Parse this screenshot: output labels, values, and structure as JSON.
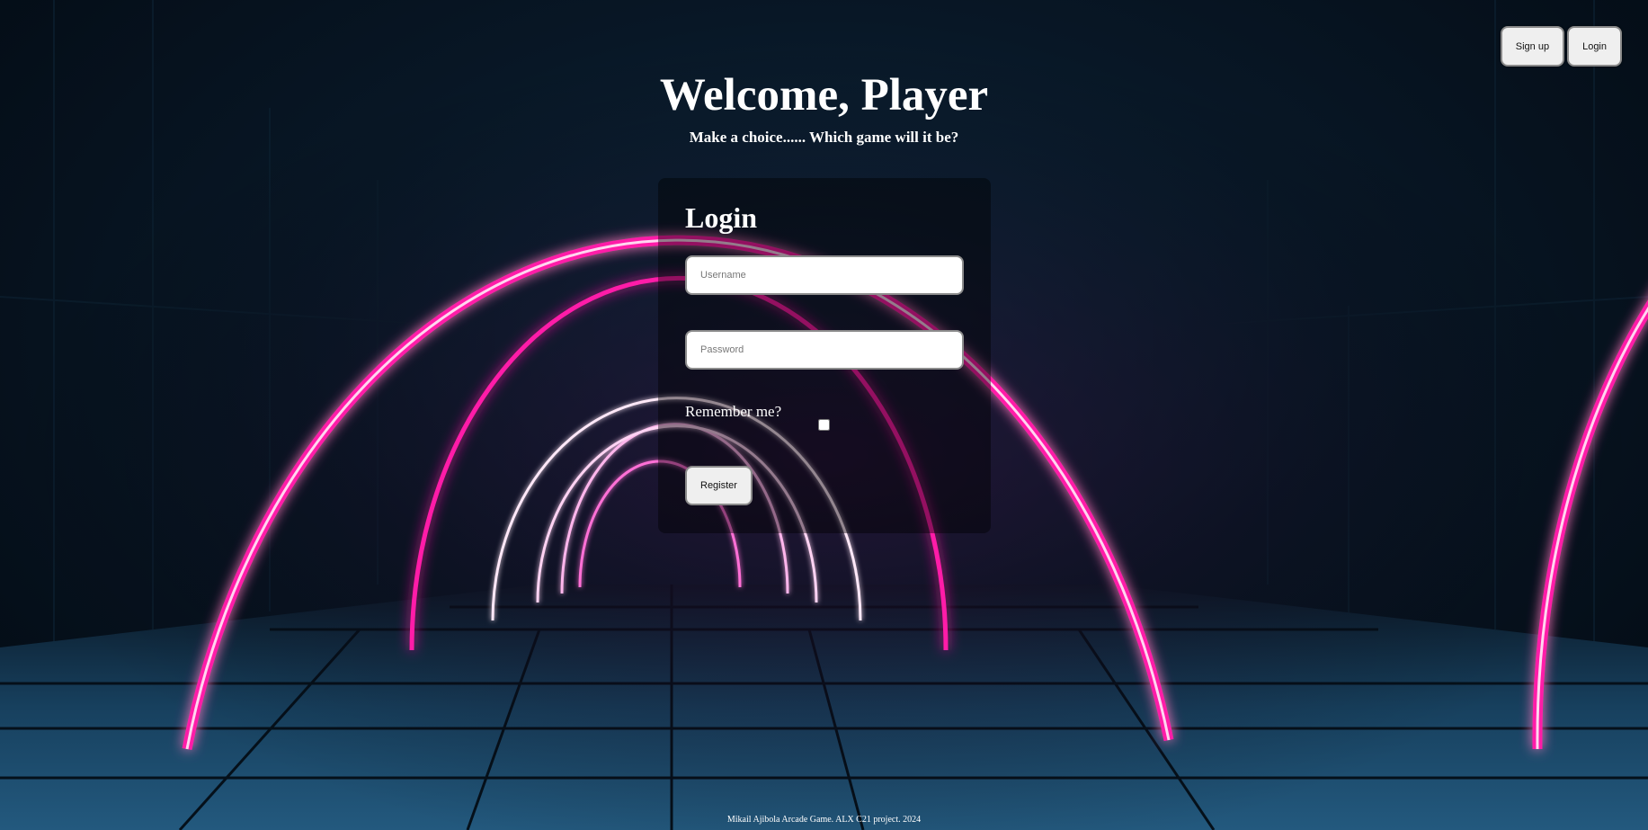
{
  "header": {
    "title": "Welcome, Player",
    "subtitle": "Make a choice...... Which game will it be?"
  },
  "nav": {
    "signup_label": "Sign up",
    "login_label": "Login"
  },
  "login_form": {
    "heading": "Login",
    "username_placeholder": "Username",
    "password_placeholder": "Password",
    "remember_label": "Remember me?",
    "remember_checked": false,
    "submit_label": "Register"
  },
  "footer": {
    "text": "Mikail Ajibola Arcade Game. ALX C21 project. 2024"
  },
  "colors": {
    "neon_pink": "#ff1aa8",
    "background_dark": "#081726",
    "tile_blue": "#2f6f9a"
  }
}
